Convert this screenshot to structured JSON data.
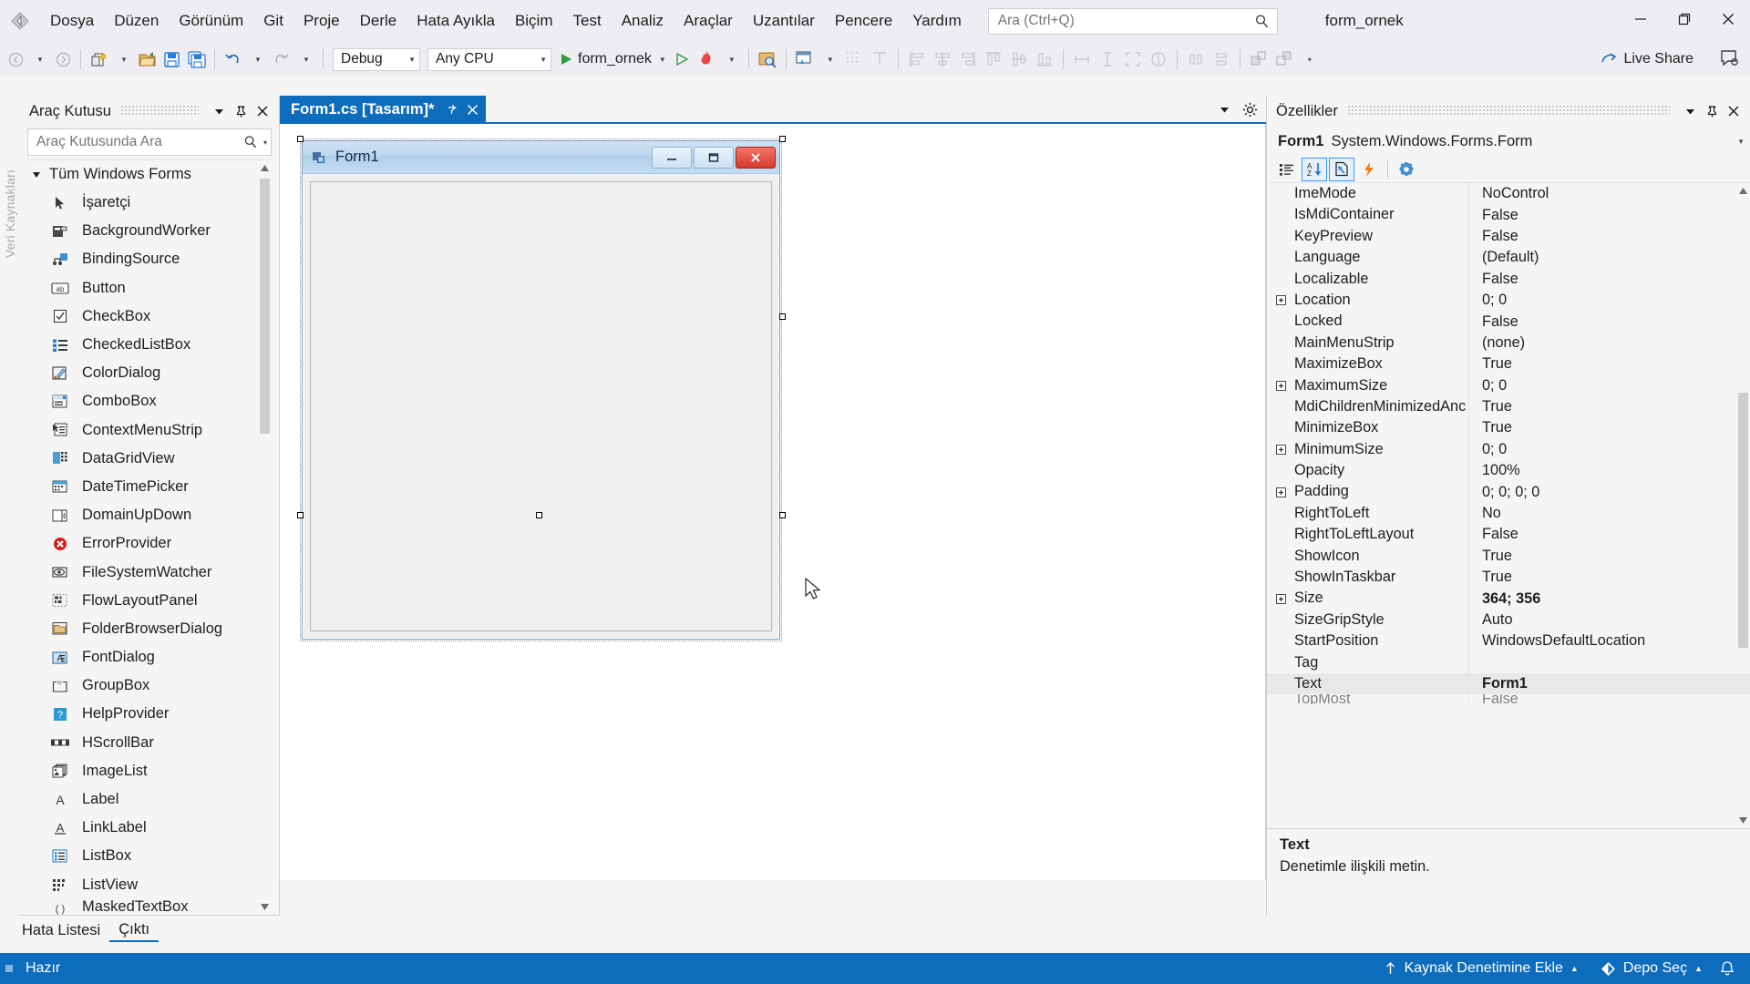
{
  "app": {
    "solution_name": "form_ornek",
    "left_vertical_tab": "Veri Kaynakları"
  },
  "menubar": {
    "items": [
      {
        "label": "Dosya"
      },
      {
        "label": "Düzen"
      },
      {
        "label": "Görünüm"
      },
      {
        "label": "Git"
      },
      {
        "label": "Proje"
      },
      {
        "label": "Derle"
      },
      {
        "label": "Hata Ayıkla"
      },
      {
        "label": "Biçim"
      },
      {
        "label": "Test"
      },
      {
        "label": "Analiz"
      },
      {
        "label": "Araçlar"
      },
      {
        "label": "Uzantılar"
      },
      {
        "label": "Pencere"
      },
      {
        "label": "Yardım"
      }
    ],
    "search_placeholder": "Ara (Ctrl+Q)",
    "search_value": "",
    "window_buttons": {
      "minimize": "minimize-icon",
      "restore": "restore-icon",
      "close": "close-icon"
    }
  },
  "toolbar": {
    "configuration": "Debug",
    "platform": "Any CPU",
    "start_label": "form_ornek",
    "live_share": "Live Share",
    "icons": [
      "back-navigate-icon",
      "forward-navigate-icon",
      "new-project-icon",
      "open-file-icon",
      "save-icon",
      "save-all-icon",
      "undo-icon",
      "redo-icon",
      "start-debug-icon",
      "start-without-debug-icon",
      "hot-reload-icon",
      "select-tool-icon",
      "designer-tool-icon"
    ]
  },
  "toolbox": {
    "title": "Araç Kutusu",
    "search_placeholder": "Araç Kutusunda Ara",
    "search_value": "",
    "group": "Tüm Windows Forms",
    "items": [
      {
        "label": "İşaretçi",
        "icon": "pointer-icon"
      },
      {
        "label": "BackgroundWorker",
        "icon": "backgroundworker-icon"
      },
      {
        "label": "BindingSource",
        "icon": "bindingsource-icon"
      },
      {
        "label": "Button",
        "icon": "button-icon"
      },
      {
        "label": "CheckBox",
        "icon": "checkbox-icon"
      },
      {
        "label": "CheckedListBox",
        "icon": "checkedlistbox-icon"
      },
      {
        "label": "ColorDialog",
        "icon": "colordialog-icon"
      },
      {
        "label": "ComboBox",
        "icon": "combobox-icon"
      },
      {
        "label": "ContextMenuStrip",
        "icon": "contextmenustrip-icon"
      },
      {
        "label": "DataGridView",
        "icon": "datagridview-icon"
      },
      {
        "label": "DateTimePicker",
        "icon": "datetimepicker-icon"
      },
      {
        "label": "DomainUpDown",
        "icon": "domainupdown-icon"
      },
      {
        "label": "ErrorProvider",
        "icon": "errorprovider-icon"
      },
      {
        "label": "FileSystemWatcher",
        "icon": "filesystemwatcher-icon"
      },
      {
        "label": "FlowLayoutPanel",
        "icon": "flowlayoutpanel-icon"
      },
      {
        "label": "FolderBrowserDialog",
        "icon": "folderbrowserdialog-icon"
      },
      {
        "label": "FontDialog",
        "icon": "fontdialog-icon"
      },
      {
        "label": "GroupBox",
        "icon": "groupbox-icon"
      },
      {
        "label": "HelpProvider",
        "icon": "helpprovider-icon"
      },
      {
        "label": "HScrollBar",
        "icon": "hscrollbar-icon"
      },
      {
        "label": "ImageList",
        "icon": "imagelist-icon"
      },
      {
        "label": "Label",
        "icon": "label-icon"
      },
      {
        "label": "LinkLabel",
        "icon": "linklabel-icon"
      },
      {
        "label": "ListBox",
        "icon": "listbox-icon"
      },
      {
        "label": "ListView",
        "icon": "listview-icon"
      },
      {
        "label": "MaskedTextBox",
        "icon": "maskedtextbox-icon"
      }
    ]
  },
  "document": {
    "tab_label": "Form1.cs [Tasarım]*",
    "pin_icon": "pin-icon",
    "close_icon": "close-icon"
  },
  "designer": {
    "form_title": "Form1",
    "form_icon": "form-icon",
    "minimize": "minimize-icon",
    "maximize": "maximize-icon",
    "close": "close-icon"
  },
  "properties": {
    "title": "Özellikler",
    "object_name": "Form1",
    "object_type": "System.Windows.Forms.Form",
    "toolbar_buttons": [
      {
        "name": "categorized-icon",
        "active": false
      },
      {
        "name": "alphabetical-icon",
        "active": true
      },
      {
        "name": "properties-page-icon",
        "active": true
      },
      {
        "name": "events-icon",
        "active": false
      },
      {
        "name": "property-pages-icon",
        "active": false
      }
    ],
    "rows": [
      {
        "name": "ImeMode",
        "value": "NoControl",
        "expandable": false,
        "bold": false,
        "selected": false
      },
      {
        "name": "IsMdiContainer",
        "value": "False",
        "expandable": false,
        "bold": false,
        "selected": false
      },
      {
        "name": "KeyPreview",
        "value": "False",
        "expandable": false,
        "bold": false,
        "selected": false
      },
      {
        "name": "Language",
        "value": "(Default)",
        "expandable": false,
        "bold": false,
        "selected": false
      },
      {
        "name": "Localizable",
        "value": "False",
        "expandable": false,
        "bold": false,
        "selected": false
      },
      {
        "name": "Location",
        "value": "0; 0",
        "expandable": true,
        "bold": false,
        "selected": false
      },
      {
        "name": "Locked",
        "value": "False",
        "expandable": false,
        "bold": false,
        "selected": false
      },
      {
        "name": "MainMenuStrip",
        "value": "(none)",
        "expandable": false,
        "bold": false,
        "selected": false
      },
      {
        "name": "MaximizeBox",
        "value": "True",
        "expandable": false,
        "bold": false,
        "selected": false
      },
      {
        "name": "MaximumSize",
        "value": "0; 0",
        "expandable": true,
        "bold": false,
        "selected": false
      },
      {
        "name": "MdiChildrenMinimizedAnc",
        "value": "True",
        "expandable": false,
        "bold": false,
        "selected": false
      },
      {
        "name": "MinimizeBox",
        "value": "True",
        "expandable": false,
        "bold": false,
        "selected": false
      },
      {
        "name": "MinimumSize",
        "value": "0; 0",
        "expandable": true,
        "bold": false,
        "selected": false
      },
      {
        "name": "Opacity",
        "value": "100%",
        "expandable": false,
        "bold": false,
        "selected": false
      },
      {
        "name": "Padding",
        "value": "0; 0; 0; 0",
        "expandable": true,
        "bold": false,
        "selected": false
      },
      {
        "name": "RightToLeft",
        "value": "No",
        "expandable": false,
        "bold": false,
        "selected": false
      },
      {
        "name": "RightToLeftLayout",
        "value": "False",
        "expandable": false,
        "bold": false,
        "selected": false
      },
      {
        "name": "ShowIcon",
        "value": "True",
        "expandable": false,
        "bold": false,
        "selected": false
      },
      {
        "name": "ShowInTaskbar",
        "value": "True",
        "expandable": false,
        "bold": false,
        "selected": false
      },
      {
        "name": "Size",
        "value": "364; 356",
        "expandable": true,
        "bold": true,
        "selected": false
      },
      {
        "name": "SizeGripStyle",
        "value": "Auto",
        "expandable": false,
        "bold": false,
        "selected": false
      },
      {
        "name": "StartPosition",
        "value": "WindowsDefaultLocation",
        "expandable": false,
        "bold": false,
        "selected": false
      },
      {
        "name": "Tag",
        "value": "",
        "expandable": false,
        "bold": false,
        "selected": false
      },
      {
        "name": "Text",
        "value": "Form1",
        "expandable": false,
        "bold": true,
        "selected": true
      },
      {
        "name": "TopMost",
        "value": "False",
        "expandable": false,
        "bold": false,
        "selected": false
      }
    ],
    "description_title": "Text",
    "description_body": "Denetimle ilişkili metin."
  },
  "bottom_tabs": [
    {
      "label": "Hata Listesi",
      "active": false
    },
    {
      "label": "Çıktı",
      "active": true
    }
  ],
  "statusbar": {
    "status": "Hazır",
    "source_control": "Kaynak Denetimine Ekle",
    "repo": "Depo Seç",
    "bell_icon": "notification-bell-icon"
  },
  "colors": {
    "accent": "#0d6cbc",
    "chrome": "#eeeef2",
    "panel": "#f5f5f5",
    "tab_active": "#0d6cbc",
    "close_red": "#e81123"
  }
}
